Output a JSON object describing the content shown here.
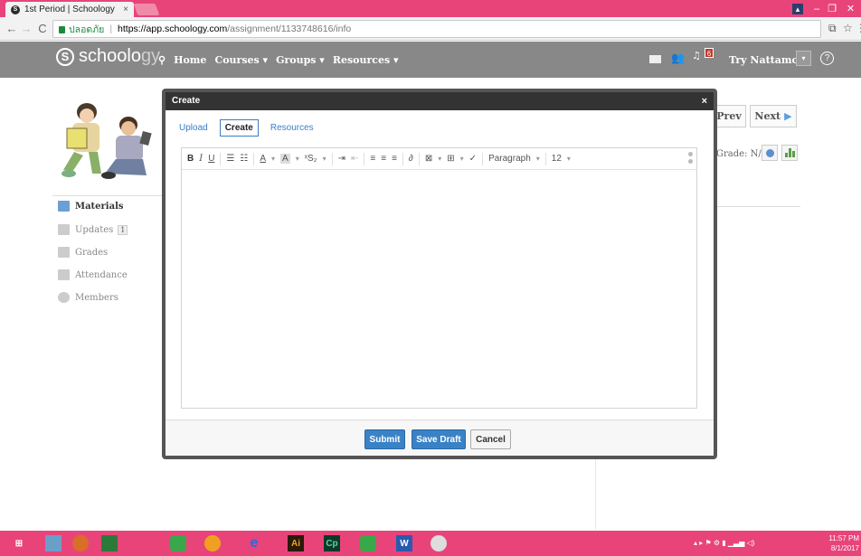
{
  "browser": {
    "tab_title": "1st Period | Schoology",
    "tab_close": "×",
    "secure_label": "ปลอดภัย",
    "url_host": "https://app.schoology.com",
    "url_path": "/assignment/1133748616/info"
  },
  "header": {
    "logo_prefix": "schoolo",
    "logo_suffix": "gy",
    "logo_mark": "S",
    "nav": [
      {
        "label": "Home"
      },
      {
        "label": "Courses ▾"
      },
      {
        "label": "Groups ▾"
      },
      {
        "label": "Resources ▾"
      }
    ],
    "notification_count": "6",
    "user_name": "Try Nattamon",
    "user_menu": "▾",
    "help": "?"
  },
  "sidebar": {
    "items": [
      {
        "label": "Materials",
        "badge": ""
      },
      {
        "label": "Updates",
        "badge": "1"
      },
      {
        "label": "Grades",
        "badge": ""
      },
      {
        "label": "Attendance",
        "badge": ""
      },
      {
        "label": "Members",
        "badge": ""
      }
    ]
  },
  "main": {
    "prev_label": "Prev",
    "next_label": "Next",
    "grade_label": "Grade: N/A"
  },
  "modal": {
    "title": "Create",
    "close": "×",
    "tabs": [
      {
        "label": "Upload",
        "active": false
      },
      {
        "label": "Create",
        "active": true
      },
      {
        "label": "Resources",
        "active": false
      }
    ],
    "toolbar": {
      "bold": "B",
      "italic": "I",
      "underline": "U",
      "paragraph": "Paragraph",
      "font_size": "12"
    },
    "buttons": {
      "submit": "Submit",
      "save_draft": "Save Draft",
      "cancel": "Cancel"
    }
  },
  "taskbar": {
    "clock_time": "11:57 PM",
    "clock_date": "8/1/2017"
  },
  "colors": {
    "chrome_accent": "#e8447a",
    "schoology_header": "#888888",
    "primary_button": "#3a82c6",
    "link": "#3b7dc4"
  }
}
